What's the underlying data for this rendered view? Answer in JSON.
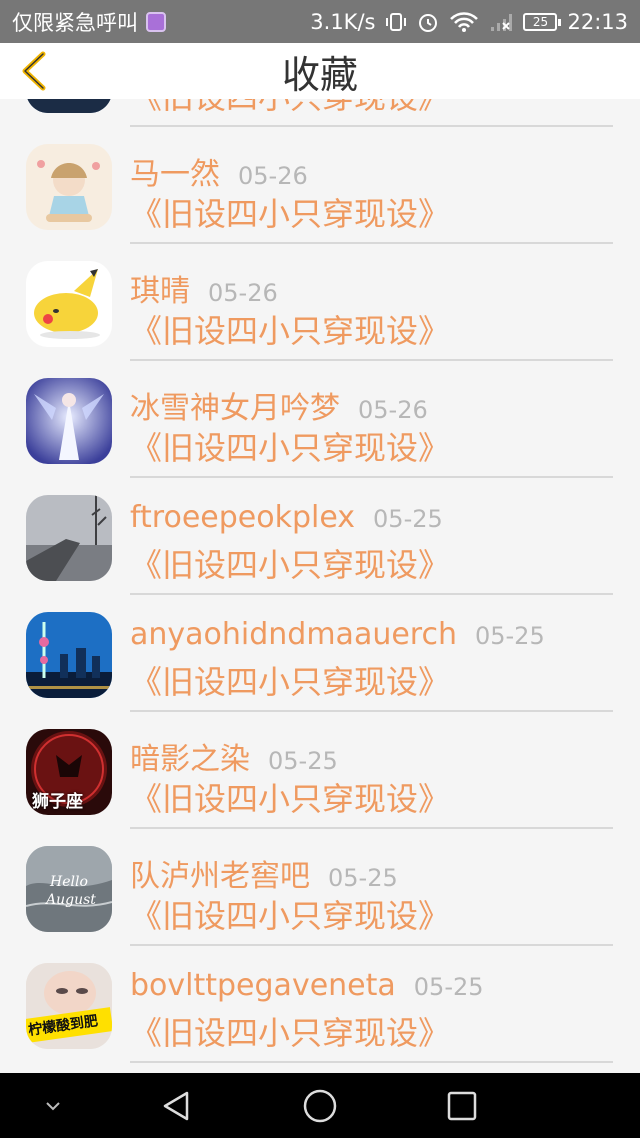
{
  "status_bar": {
    "left_text": "仅限紧急呼叫",
    "speed": "3.1K/s",
    "battery": "25",
    "time": "22:13"
  },
  "header": {
    "title": "收藏"
  },
  "items": [
    {
      "name": "",
      "date": "",
      "subject": "《旧设四小只穿现设》",
      "avatar": "landscape-avatar"
    },
    {
      "name": "马一然",
      "date": "05-26",
      "subject": "《旧设四小只穿现设》",
      "avatar": "anime-girl-avatar"
    },
    {
      "name": "琪晴",
      "date": "05-26",
      "subject": "《旧设四小只穿现设》",
      "avatar": "pikachu-avatar"
    },
    {
      "name": "冰雪神女月吟梦",
      "date": "05-26",
      "subject": "《旧设四小只穿现设》",
      "avatar": "ice-fairy-avatar"
    },
    {
      "name": "ftroeepeokplex",
      "date": "05-25",
      "subject": "《旧设四小只穿现设》",
      "avatar": "foggy-path-avatar"
    },
    {
      "name": "anyaohidndmaauerch",
      "date": "05-25",
      "subject": "《旧设四小只穿现设》",
      "avatar": "city-night-avatar"
    },
    {
      "name": "暗影之染",
      "date": "05-25",
      "subject": "《旧设四小只穿现设》",
      "avatar": "leo-zodiac-avatar"
    },
    {
      "name": "队泸州老窖吧",
      "date": "05-25",
      "subject": "《旧设四小只穿现设》",
      "avatar": "hello-august-avatar"
    },
    {
      "name": "bovlttpegaveneta",
      "date": "05-25",
      "subject": "《旧设四小只穿现设》",
      "avatar": "sour-lemon-avatar"
    }
  ],
  "avatar_text": {
    "leo": "狮子座",
    "hello": "Hello",
    "august": "August",
    "sour": "柠檬酸到肥"
  },
  "colors": {
    "accent": "#ef9a60",
    "date": "#b7b7b7",
    "divider": "#d8d8d8",
    "back_icon": "#f0b400"
  },
  "nav_bar": {
    "icons": [
      "chevron-down-icon",
      "back-triangle-icon",
      "home-circle-icon",
      "recent-square-icon"
    ]
  }
}
